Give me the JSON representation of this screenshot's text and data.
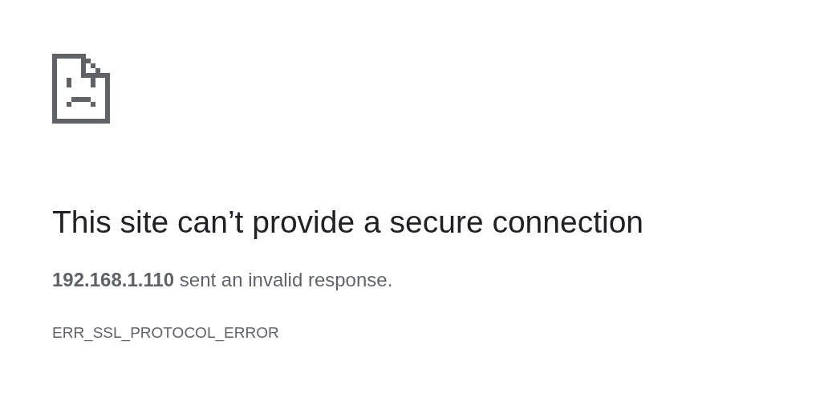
{
  "heading": "This site can’t provide a secure connection",
  "message": "**192.168.1.110** sent an invalid response.",
  "error_code": "ERR_SSL_PROTOCOL_ERROR"
}
